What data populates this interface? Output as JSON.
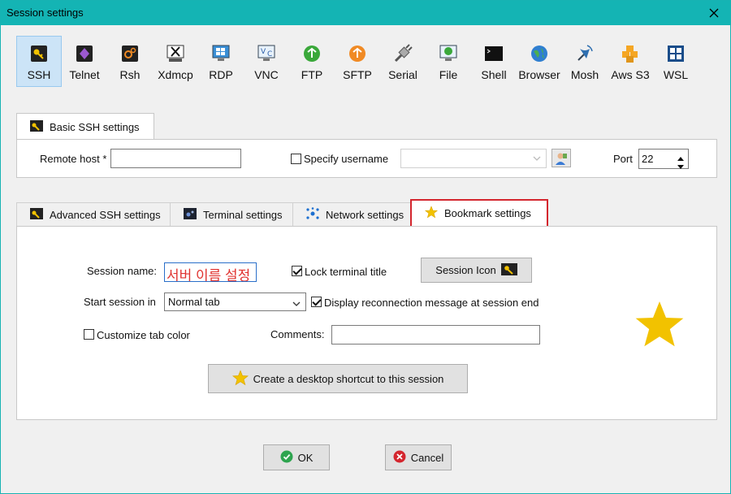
{
  "window": {
    "title": "Session settings"
  },
  "protocols": [
    {
      "label": "SSH",
      "icon": "ssh-key-icon",
      "selected": true
    },
    {
      "label": "Telnet",
      "icon": "telnet-icon"
    },
    {
      "label": "Rsh",
      "icon": "rsh-icon"
    },
    {
      "label": "Xdmcp",
      "icon": "xdmcp-icon"
    },
    {
      "label": "RDP",
      "icon": "rdp-icon"
    },
    {
      "label": "VNC",
      "icon": "vnc-icon"
    },
    {
      "label": "FTP",
      "icon": "ftp-icon"
    },
    {
      "label": "SFTP",
      "icon": "sftp-icon"
    },
    {
      "label": "Serial",
      "icon": "serial-icon"
    },
    {
      "label": "File",
      "icon": "file-icon"
    },
    {
      "label": "Shell",
      "icon": "shell-icon"
    },
    {
      "label": "Browser",
      "icon": "browser-icon"
    },
    {
      "label": "Mosh",
      "icon": "mosh-icon"
    },
    {
      "label": "Aws S3",
      "icon": "aws-s3-icon"
    },
    {
      "label": "WSL",
      "icon": "wsl-icon"
    }
  ],
  "basic": {
    "tab_label": "Basic SSH settings",
    "remote_host_label": "Remote host *",
    "remote_host_value": "",
    "specify_username_label": "Specify username",
    "specify_username_checked": false,
    "username_value": "",
    "port_label": "Port",
    "port_value": "22"
  },
  "tabs": {
    "advanced": "Advanced SSH settings",
    "terminal": "Terminal settings",
    "network": "Network settings",
    "bookmark": "Bookmark settings"
  },
  "bookmark": {
    "session_name_label": "Session name:",
    "session_name_value": "서버 이름 설정",
    "lock_title_label": "Lock terminal title",
    "lock_title_checked": true,
    "session_icon_button": "Session Icon",
    "start_session_label": "Start session in",
    "start_session_value": "Normal tab",
    "display_reconnect_label": "Display reconnection message at session end",
    "display_reconnect_checked": true,
    "customize_tab_color_label": "Customize tab color",
    "customize_tab_color_checked": false,
    "comments_label": "Comments:",
    "comments_value": "",
    "desktop_shortcut_button": "Create a desktop shortcut to this session"
  },
  "footer": {
    "ok": "OK",
    "cancel": "Cancel"
  },
  "colors": {
    "titlebar": "#14b4b4",
    "accent_red": "#d4262e",
    "star": "#f2c200"
  }
}
